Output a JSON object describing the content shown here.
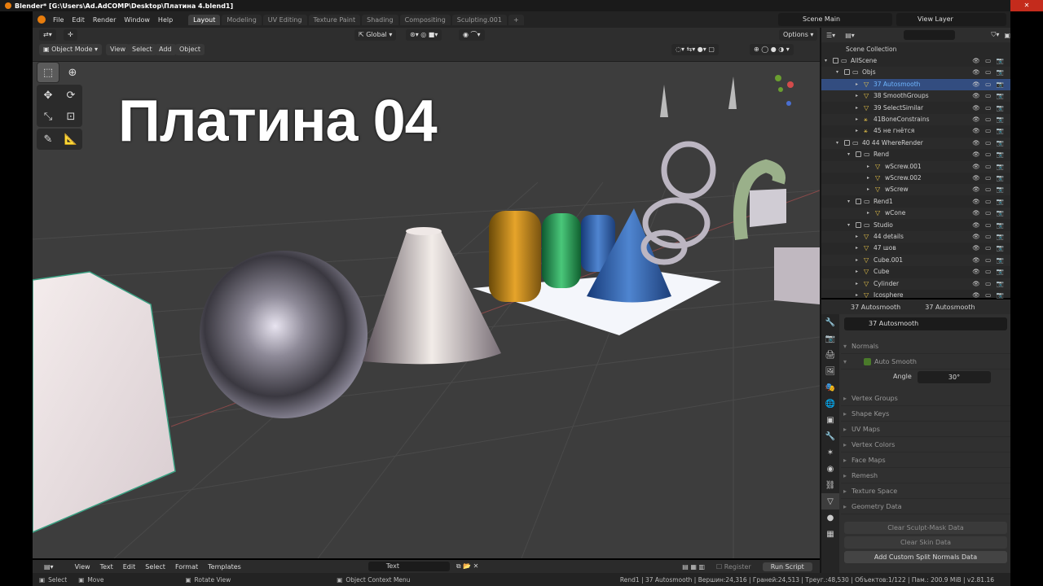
{
  "window": {
    "title": "Blender* [G:\\Users\\Ad.AdCOMP\\Desktop\\Платина 4.blend1]"
  },
  "menu": [
    "File",
    "Edit",
    "Render",
    "Window",
    "Help"
  ],
  "workspaces": [
    {
      "label": "Layout",
      "active": true
    },
    {
      "label": "Modeling",
      "active": false
    },
    {
      "label": "UV Editing",
      "active": false
    },
    {
      "label": "Texture Paint",
      "active": false
    },
    {
      "label": "Shading",
      "active": false
    },
    {
      "label": "Compositing",
      "active": false
    },
    {
      "label": "Sculpting.001",
      "active": false
    }
  ],
  "scene": {
    "name": "Scene Main",
    "view_layer": "View Layer"
  },
  "viewport": {
    "transform_orientation": "Global",
    "options_label": "Options",
    "mode": "Object Mode",
    "menus": [
      "View",
      "Select",
      "Add",
      "Object"
    ],
    "overlay_title": "Платина 04"
  },
  "outliner": {
    "root": "Scene Collection",
    "rows": [
      {
        "name": "AllScene",
        "indent": 1,
        "type": "collection",
        "vis": "👁 ▭ 📷"
      },
      {
        "name": "Objs",
        "indent": 2,
        "type": "collection",
        "vis": "👁 ▭ 📷"
      },
      {
        "name": "37 Autosmooth",
        "indent": 3,
        "type": "mesh",
        "selected": true,
        "vis": "👁 ▭ 📷"
      },
      {
        "name": "38 SmoothGroups",
        "indent": 3,
        "type": "mesh",
        "vis": "👁 ▭ 📷"
      },
      {
        "name": "39 SelectSimilar",
        "indent": 3,
        "type": "mesh",
        "vis": "👁 ▭ 📷"
      },
      {
        "name": "41BoneConstrains",
        "indent": 3,
        "type": "armature",
        "vis": "👁 ▭ 📷"
      },
      {
        "name": "45 не гнётся",
        "indent": 3,
        "type": "armature",
        "vis": "👁 ▭ 📷"
      },
      {
        "name": "40 44 WhereRender",
        "indent": 2,
        "type": "collection",
        "vis": "👁 ▭ 📷"
      },
      {
        "name": "Rend",
        "indent": 3,
        "type": "collection",
        "vis": "👁 ▭ 📷"
      },
      {
        "name": "wScrew.001",
        "indent": 4,
        "type": "mesh",
        "vis": "👁 ▭ 📷"
      },
      {
        "name": "wScrew.002",
        "indent": 4,
        "type": "mesh",
        "vis": "👁 ▭ 📷"
      },
      {
        "name": "wScrew",
        "indent": 4,
        "type": "mesh",
        "vis": "👁 ▭ 📷"
      },
      {
        "name": "Rend1",
        "indent": 3,
        "type": "collection",
        "vis": "👁 ▭ 📷"
      },
      {
        "name": "wCone",
        "indent": 4,
        "type": "mesh",
        "vis": "👁 ▭ 📷"
      },
      {
        "name": "Studio",
        "indent": 3,
        "type": "collection",
        "vis": "👁 ▭ 📷"
      },
      {
        "name": "44 details",
        "indent": 3,
        "type": "mesh",
        "vis": "👁 ▭ 📷"
      },
      {
        "name": "47 шов",
        "indent": 3,
        "type": "mesh",
        "vis": "👁 ▭ 📷"
      },
      {
        "name": "Cube.001",
        "indent": 3,
        "type": "mesh",
        "vis": "👁 ▭ 📷"
      },
      {
        "name": "Cube",
        "indent": 3,
        "type": "mesh",
        "vis": "👁 ▭ 📷"
      },
      {
        "name": "Cylinder",
        "indent": 3,
        "type": "mesh",
        "vis": "👁 ▭ 📷"
      },
      {
        "name": "Icosphere",
        "indent": 3,
        "type": "mesh",
        "vis": "👁 ▭ 📷"
      }
    ]
  },
  "properties": {
    "object": "37 Autosmooth",
    "data": "37 Autosmooth",
    "mesh_name": "37 Autosmooth",
    "normals_label": "Normals",
    "auto_smooth_label": "Auto Smooth",
    "angle_label": "Angle",
    "angle_value": "30°",
    "sections": [
      "Vertex Groups",
      "Shape Keys",
      "UV Maps",
      "Vertex Colors",
      "Face Maps",
      "Remesh",
      "Texture Space",
      "Geometry Data"
    ],
    "buttons": [
      "Clear Sculpt-Mask Data",
      "Clear Skin Data",
      "Add Custom Split Normals Data"
    ]
  },
  "text_editor": {
    "menus": [
      "View",
      "Text",
      "Edit",
      "Select",
      "Format",
      "Templates"
    ],
    "text_name": "Text",
    "register": "Register",
    "run": "Run Script"
  },
  "statusbar": {
    "select": "Select",
    "move": "Move",
    "rotate": "Rotate View",
    "context": "Object Context Menu",
    "stats": "Rend1 | 37 Autosmooth | Вершин:24,316 | Граней:24,513 | Треуг.:48,530 | Объектов:1/122 | Пам.: 200.9 MiB | v2.81.16"
  }
}
